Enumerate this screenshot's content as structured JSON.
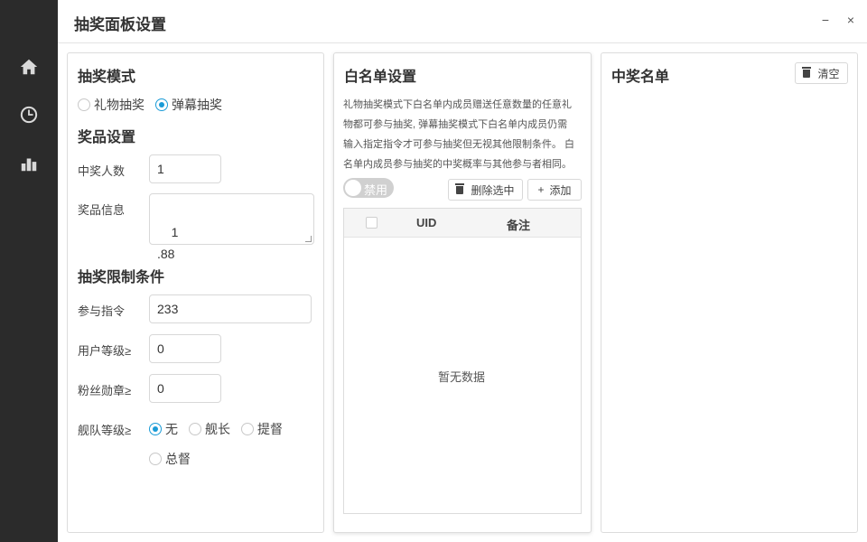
{
  "window": {
    "title": "抽奖面板设置",
    "minimize": "−",
    "close": "×"
  },
  "sidebar": {
    "items": [
      {
        "icon": "home-icon"
      },
      {
        "icon": "clock-icon"
      },
      {
        "icon": "bar-chart-icon"
      }
    ]
  },
  "left_panel": {
    "mode_title": "抽奖模式",
    "mode_options": [
      "礼物抽奖",
      "弹幕抽奖"
    ],
    "mode_selected": "弹幕抽奖",
    "prize_title": "奖品设置",
    "winners_label": "中奖人数",
    "winners_value": "1",
    "prize_info_label": "奖品信息",
    "prize_info_value": "1\n.88",
    "limit_title": "抽奖限制条件",
    "command_label": "参与指令",
    "command_value": "233",
    "user_level_label": "用户等级≥",
    "user_level_value": "0",
    "fan_medal_label": "粉丝勋章≥",
    "fan_medal_value": "0",
    "fleet_label": "舰队等级≥",
    "fleet_options": [
      "无",
      "舰长",
      "提督",
      "总督"
    ],
    "fleet_selected": "无"
  },
  "middle_panel": {
    "title": "白名单设置",
    "description_lines": [
      "礼物抽奖模式下白名单内成员赠送任意数量的任意礼",
      "物都可参与抽奖, 弹幕抽奖模式下白名单内成员仍需",
      "输入指定指令才可参与抽奖但无视其他限制条件。 白",
      "名单内成员参与抽奖的中奖概率与其他参与者相同。"
    ],
    "toggle_label": "禁用",
    "toggle_on": false,
    "delete_selected_label": "删除选中",
    "add_label": "添加",
    "table": {
      "columns": [
        "UID",
        "备注"
      ],
      "rows": [],
      "empty_text": "暂无数据"
    }
  },
  "right_panel": {
    "title": "中奖名单",
    "clear_label": "清空"
  },
  "colors": {
    "accent": "#1a9bd7",
    "sidebar_bg": "#2b2b2b"
  }
}
